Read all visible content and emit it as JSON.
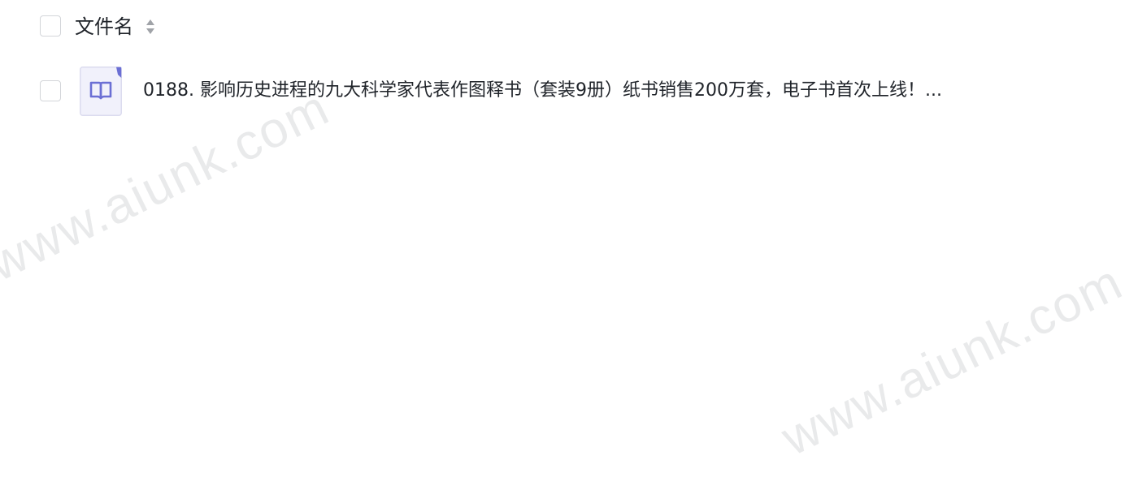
{
  "header": {
    "column_label": "文件名",
    "sort_icon": "sort-updown-icon"
  },
  "files": [
    {
      "name": "0188. 影响历史进程的九大科学家代表作图释书（套装9册）纸书销售200万套，电子书首次上线！...",
      "icon": "book-file-icon"
    }
  ],
  "watermark": {
    "text": "www.aiunk.com"
  },
  "colors": {
    "icon_accent": "#6b6fd4",
    "icon_background": "#f1f1fb",
    "checkbox_border": "#d3d5d9"
  }
}
